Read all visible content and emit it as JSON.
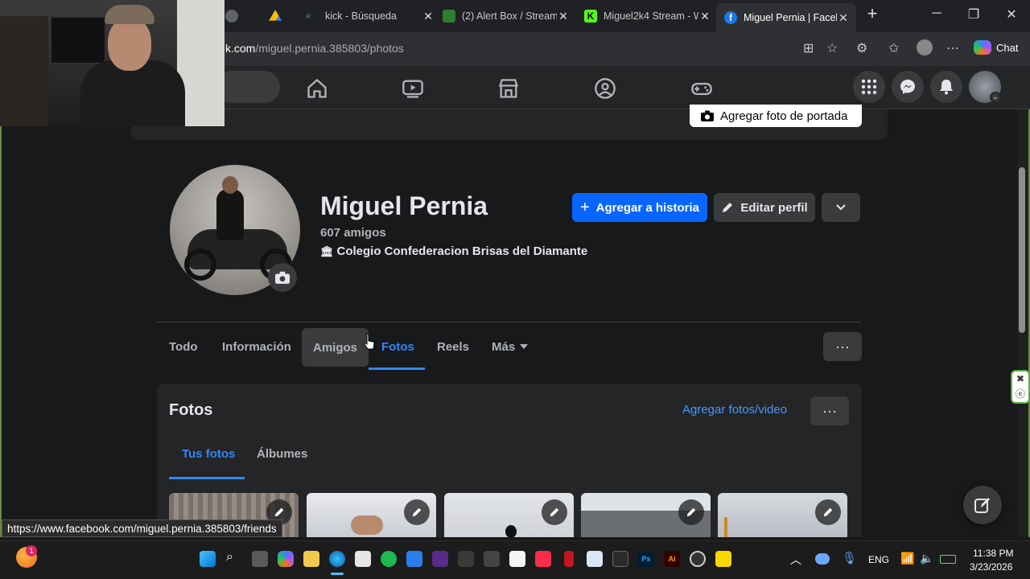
{
  "browser": {
    "tabs": [
      {
        "label": "kick - Búsqueda"
      },
      {
        "label": "(2) Alert Box / Streaml"
      },
      {
        "label": "Miguel2k4 Stream - W"
      },
      {
        "label": "Miguel Pernia | Facebo"
      }
    ],
    "url_domain": "k.com",
    "url_path": "/miguel.pernia.385803/photos",
    "copilot_label": "Chat"
  },
  "profile": {
    "add_cover_label": "Agregar foto de portada",
    "name": "Miguel Pernia",
    "friends": "607 amigos",
    "school": "Colegio Confederacion Brisas del Diamante",
    "add_story_label": "Agregar a historia",
    "edit_profile_label": "Editar perfil"
  },
  "profile_tabs": [
    {
      "label": "Todo"
    },
    {
      "label": "Información"
    },
    {
      "label": "Amigos"
    },
    {
      "label": "Fotos"
    },
    {
      "label": "Reels"
    },
    {
      "label": "Más"
    }
  ],
  "photos": {
    "title": "Fotos",
    "add_label": "Agregar fotos/video",
    "subtabs": [
      {
        "label": "Tus fotos"
      },
      {
        "label": "Álbumes"
      }
    ]
  },
  "status_url": "https://www.facebook.com/miguel.pernia.385803/friends",
  "taskbar": {
    "language": "ENG",
    "time": "11:38 PM",
    "date": "3/23/2026",
    "notification_count": "1"
  },
  "colors": {
    "facebook_blue": "#0866ff",
    "link_blue": "#2d88ff",
    "page_background": "#18191a",
    "card_background": "#242526"
  }
}
